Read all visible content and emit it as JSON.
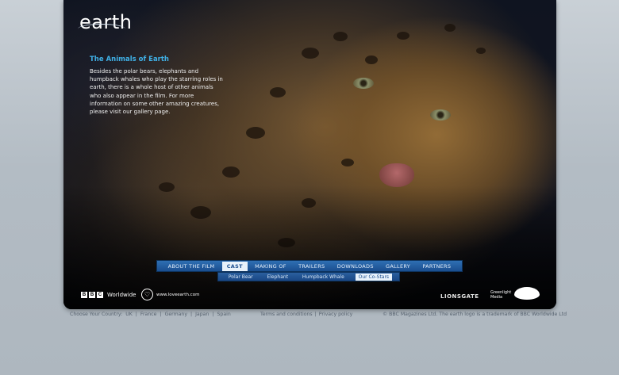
{
  "brand": {
    "logo_text": "earth"
  },
  "intro": {
    "title": "The Animals of Earth",
    "body": "Besides the polar bears, elephants and humpback whales who play the starring roles in earth, there is a whole host of other animals who also appear in the film. For more information on some other amazing creatures, please visit our gallery page."
  },
  "nav": {
    "items": [
      {
        "label": "ABOUT THE FILM",
        "active": false
      },
      {
        "label": "CAST",
        "active": true
      },
      {
        "label": "MAKING OF",
        "active": false
      },
      {
        "label": "TRAILERS",
        "active": false
      },
      {
        "label": "DOWNLOADS",
        "active": false
      },
      {
        "label": "GALLERY",
        "active": false
      },
      {
        "label": "PARTNERS",
        "active": false
      }
    ]
  },
  "subnav": {
    "items": [
      {
        "label": "Polar Bear",
        "active": false
      },
      {
        "label": "Elephant",
        "active": false
      },
      {
        "label": "Humpback Whale",
        "active": false
      },
      {
        "label": "Our Co-Stars",
        "active": true
      }
    ]
  },
  "logos": {
    "bbc_letters": [
      "B",
      "B",
      "C"
    ],
    "bbc_text": "Worldwide",
    "love_url": "www.loveearth.com",
    "lionsgate": "LIONSGATE",
    "greenlight": "Greenlight Media"
  },
  "footer": {
    "country_label": "Choose Your Country:",
    "countries": [
      "UK",
      "France",
      "Germany",
      "Japan",
      "Spain"
    ],
    "terms": "Terms and conditions",
    "privacy": "Privacy policy",
    "copyright": "© BBC Magazines Ltd. The earth logo is a trademark of BBC Worldwide Ltd"
  },
  "colors": {
    "accent": "#3fb0e6",
    "nav_blue": "#1a4e8f",
    "page_bg": "#b3bcc4"
  }
}
